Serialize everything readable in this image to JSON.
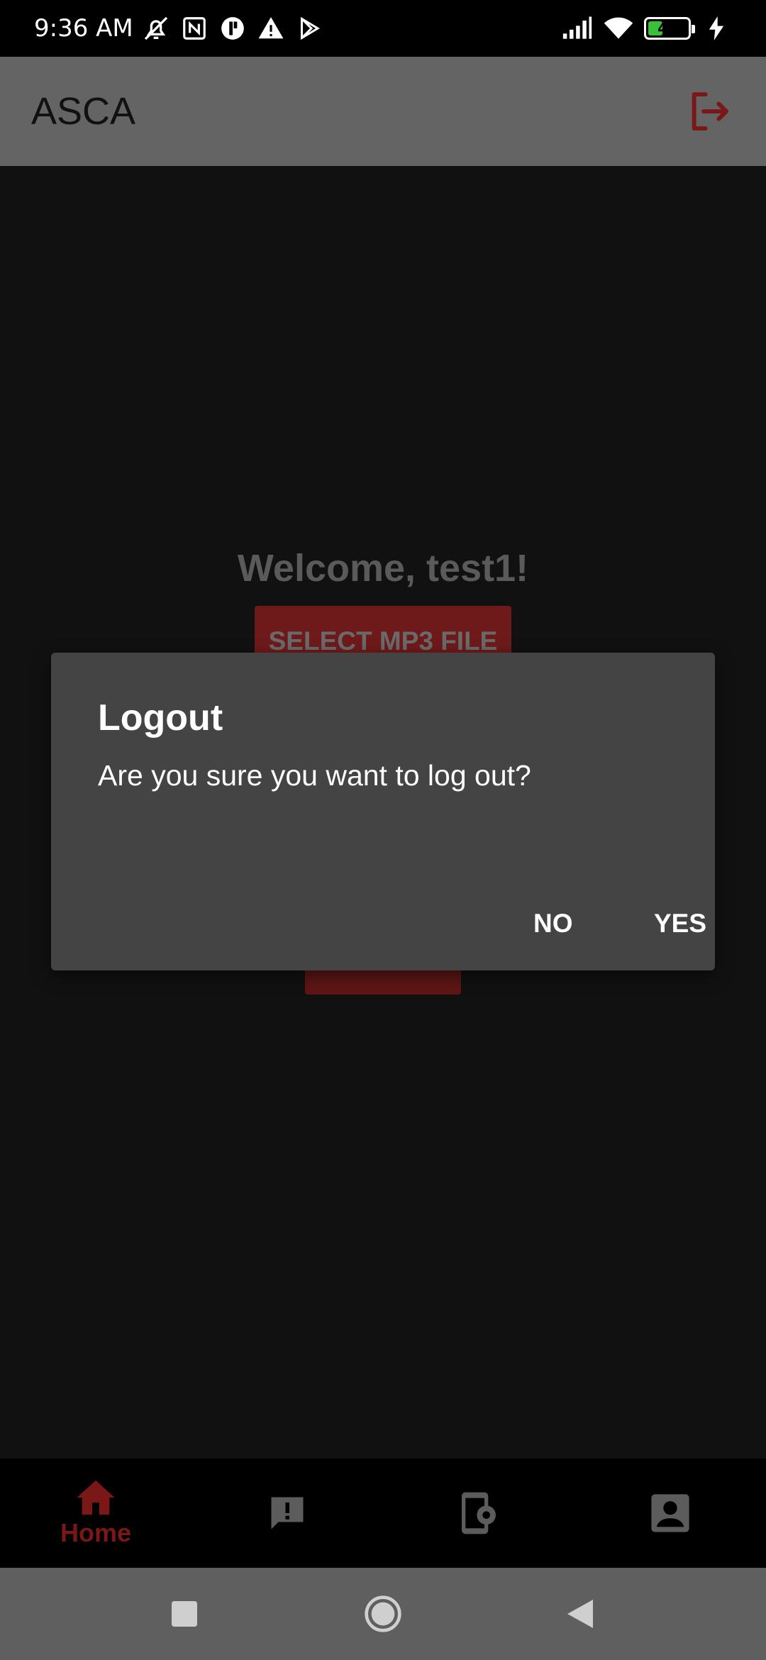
{
  "status_bar": {
    "time": "9:36 AM",
    "battery_level": "43",
    "battery_percent": 43,
    "left_icons": [
      "mute-alarm-icon",
      "nfc-icon",
      "app-notification-icon",
      "warning-icon",
      "play-store-icon"
    ],
    "right_icons": [
      "signal-icon",
      "wifi-icon",
      "battery-icon",
      "charging-icon"
    ]
  },
  "app_bar": {
    "title": "ASCA",
    "action_icon": "logout-icon"
  },
  "content": {
    "welcome": "Welcome, test1!",
    "select_button": "SELECT MP3 FILE"
  },
  "dialog": {
    "title": "Logout",
    "message": "Are you sure you want to log out?",
    "no_label": "NO",
    "yes_label": "YES"
  },
  "bottom_nav": {
    "items": [
      {
        "label": "Home",
        "icon": "home-icon",
        "active": true
      },
      {
        "label": "",
        "icon": "report-icon",
        "active": false
      },
      {
        "label": "",
        "icon": "device-settings-icon",
        "active": false
      },
      {
        "label": "",
        "icon": "account-icon",
        "active": false
      }
    ]
  },
  "system_nav": [
    "recents-icon",
    "home-circle-icon",
    "back-icon"
  ],
  "colors": {
    "accent": "#7a1717",
    "app_bar": "#646464",
    "background": "#111111",
    "dialog": "#444444"
  }
}
